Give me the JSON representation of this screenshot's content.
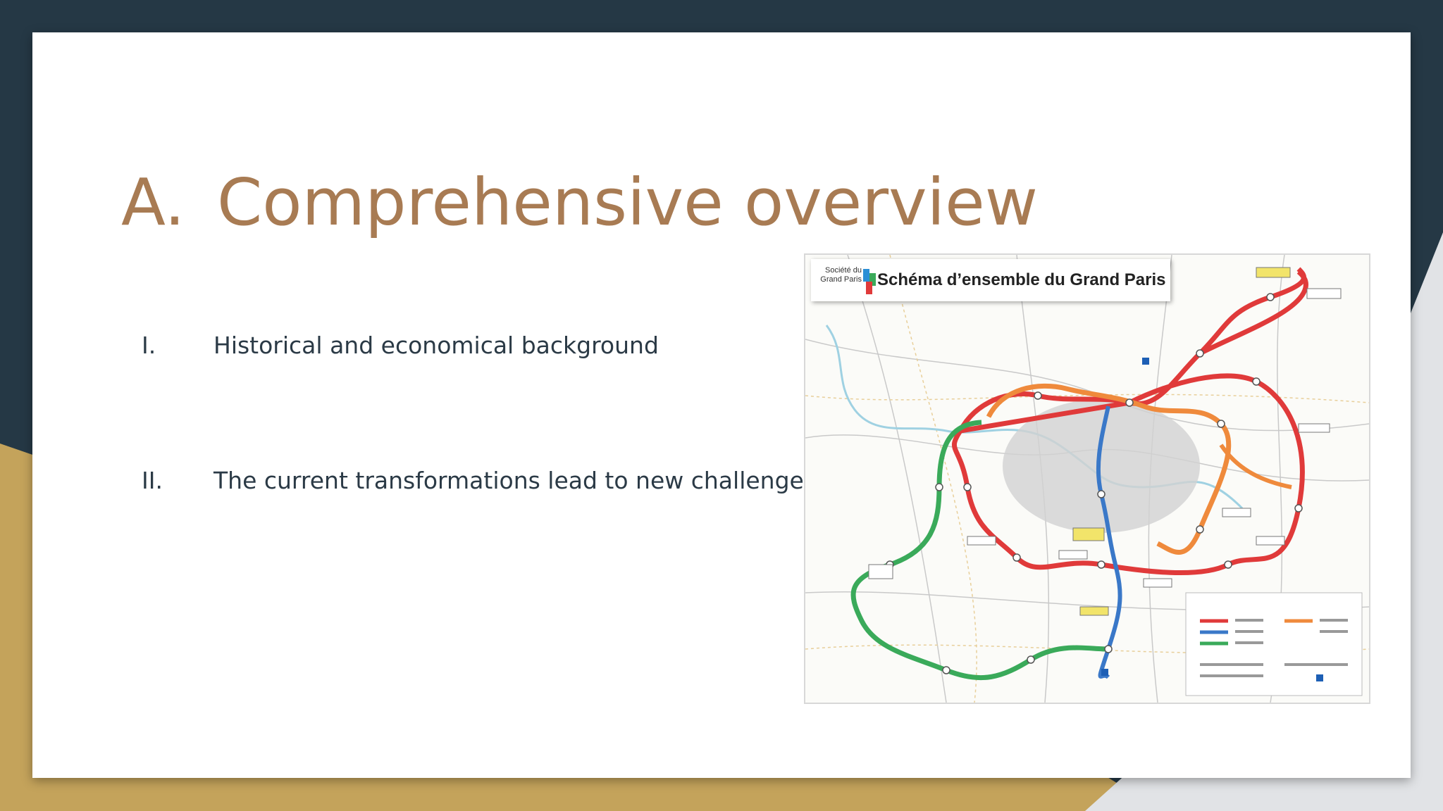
{
  "slide": {
    "title_number": "A.",
    "title_text": "Comprehensive overview",
    "items": [
      {
        "number": "I.",
        "text": "Historical and economical background"
      },
      {
        "number": "II.",
        "text": "The current transformations lead to new challenges"
      }
    ]
  },
  "map": {
    "logo_text": "Société du Grand Paris",
    "title": "Schéma d’ensemble du Grand Paris"
  },
  "colors": {
    "background": "#253845",
    "accent_gold": "#c4a35b",
    "title_color": "#a87b53",
    "line_red": "#e03a3a",
    "line_orange": "#ef8a3c",
    "line_green": "#3aaa5a",
    "line_blue": "#3a78c8"
  }
}
